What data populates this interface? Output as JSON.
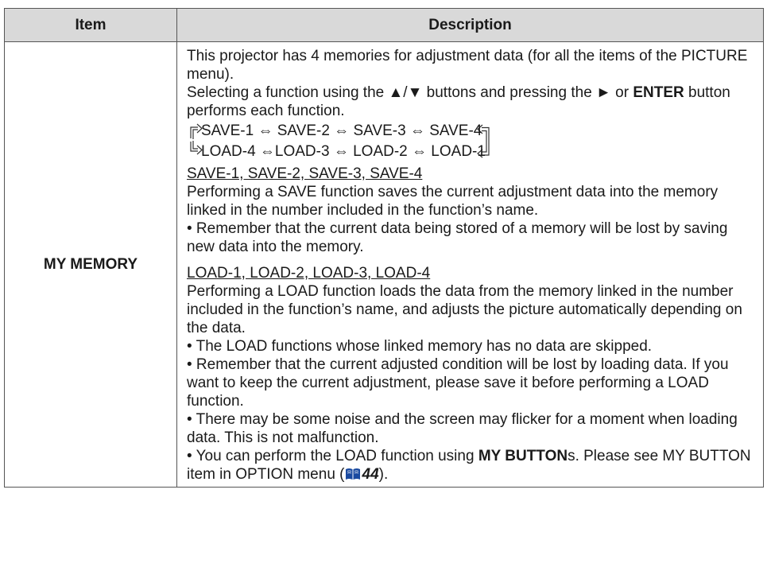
{
  "table": {
    "header_item": "Item",
    "header_description": "Description"
  },
  "row": {
    "item": "MY MEMORY",
    "intro1": "This projector has 4 memories for adjustment data (for all the items of the PICTURE menu).",
    "intro2_prefix": "Selecting a function using the ▲/▼ buttons and pressing the ► or ",
    "intro2_bold": "ENTER",
    "intro2_suffix": " button performs each function.",
    "flow_line1": "SAVE-1 ⇔ SAVE-2 ⇔ SAVE-3 ⇔ SAVE-4",
    "flow_line2": "LOAD-4 ⇔LOAD-3 ⇔ LOAD-2 ⇔ LOAD-1",
    "save_heading": "SAVE-1, SAVE-2, SAVE-3, SAVE-4",
    "save_text": "Performing a SAVE function saves the current adjustment data into the memory linked in the number included in the function’s name.",
    "save_note": "• Remember that the current data being stored of a memory will be lost by saving new data into the memory.",
    "load_heading": "LOAD-1, LOAD-2, LOAD-3, LOAD-4",
    "load_text": "Performing a LOAD function loads the data from the memory linked in the number included in the function’s name, and adjusts the picture automatically depending on the data.",
    "load_note1": "• The LOAD functions whose linked memory has no data are skipped.",
    "load_note2": "• Remember that the current adjusted condition will be lost by loading data. If you want to keep the current adjustment, please save it before performing a LOAD function.",
    "load_note3": "• There may be some noise and the screen may flicker for a moment when loading data. This is not malfunction.",
    "load_note4_prefix": "• You can perform the LOAD function using ",
    "load_note4_bold": "MY BUTTON",
    "load_note4_mid": "s. Please see MY BUTTON item in OPTION menu (",
    "load_note4_page": "44",
    "load_note4_suffix": ")."
  },
  "icons": {
    "manual_ref": "book-icon",
    "flow_arrows": "loop-arrow-icon"
  },
  "colors": {
    "header_bg": "#d9d9d9",
    "border": "#555555",
    "book_icon": "#1a4aa0"
  }
}
